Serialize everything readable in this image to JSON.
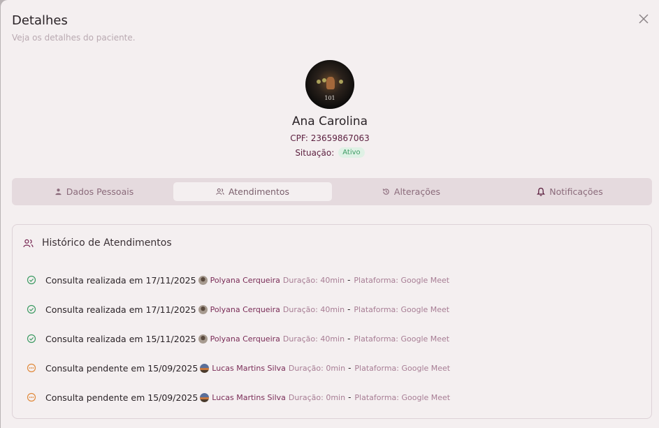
{
  "modal": {
    "title": "Detalhes",
    "subtitle": "Veja os detalhes do paciente.",
    "close_icon": "close-icon"
  },
  "patient": {
    "avatar_caption": "101",
    "name": "Ana Carolina",
    "cpf_label": "CPF:",
    "cpf": "23659867063",
    "situacao_label": "Situação:",
    "situacao": "Ativo"
  },
  "tabs": [
    {
      "label": "Dados Pessoais",
      "icon": "user-icon",
      "active": false
    },
    {
      "label": "Atendimentos",
      "icon": "users-icon",
      "active": true
    },
    {
      "label": "Alterações",
      "icon": "history-icon",
      "active": false
    },
    {
      "label": "Notificações",
      "icon": "bell-icon",
      "active": false
    }
  ],
  "history": {
    "title": "Histórico de Atendimentos",
    "icon": "users-icon",
    "items": [
      {
        "status": "done",
        "text": "Consulta realizada em 17/11/2025",
        "professional": "Polyana Cerqueira",
        "duration": "Duração: 40min",
        "separator": "-",
        "platform": "Plataforma: Google Meet"
      },
      {
        "status": "done",
        "text": "Consulta realizada em 17/11/2025",
        "professional": "Polyana Cerqueira",
        "duration": "Duração: 40min",
        "separator": "-",
        "platform": "Plataforma: Google Meet"
      },
      {
        "status": "done",
        "text": "Consulta realizada em 15/11/2025",
        "professional": "Polyana Cerqueira",
        "duration": "Duração: 40min",
        "separator": "-",
        "platform": "Plataforma: Google Meet"
      },
      {
        "status": "pending",
        "text": "Consulta pendente em 15/09/2025",
        "professional": "Lucas Martins Silva",
        "duration": "Duração: 0min",
        "separator": "-",
        "platform": "Plataforma: Google Meet"
      },
      {
        "status": "pending",
        "text": "Consulta pendente em 15/09/2025",
        "professional": "Lucas Martins Silva",
        "duration": "Duração: 0min",
        "separator": "-",
        "platform": "Plataforma: Google Meet"
      }
    ]
  },
  "colors": {
    "done": "#3d9b63",
    "pending": "#e08a3c",
    "accent": "#7a2c57"
  }
}
